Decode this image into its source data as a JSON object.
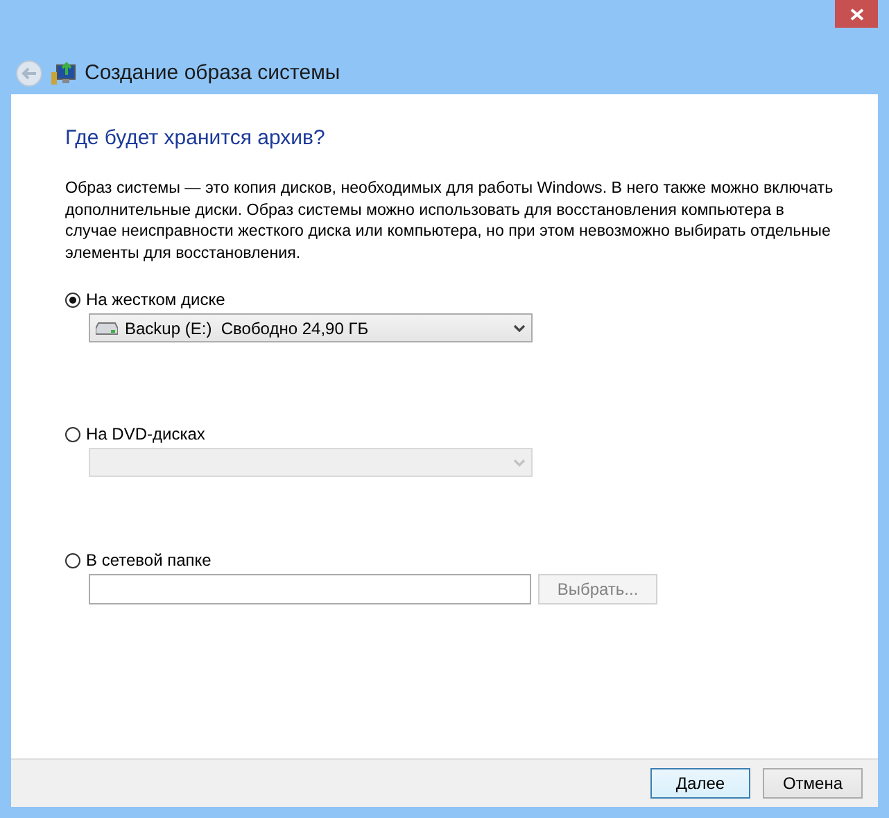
{
  "window": {
    "title": "Создание образа системы"
  },
  "heading": "Где будет хранится архив?",
  "description": "Образ системы — это копия дисков, необходимых для работы Windows. В него также можно включать дополнительные диски. Образ системы можно использовать для восстановления компьютера в случае неисправности жесткого диска или компьютера, но при этом невозможно выбирать отдельные элементы для восстановления.",
  "targets": [
    {
      "kind": "dropdown",
      "label": "На жестком диске",
      "selected": true,
      "disabled": false,
      "value": "Backup (E:)  Свободно 24,90 ГБ"
    },
    {
      "kind": "dropdown",
      "label": "На DVD-дисках",
      "selected": false,
      "disabled": true
    },
    {
      "kind": "path",
      "label": "В сетевой папке",
      "selected": false,
      "browse": {
        "label": "Выбрать...",
        "disabled": true
      }
    }
  ],
  "buttons": [
    {
      "label": "Далее",
      "default": true
    },
    {
      "label": "Отмена",
      "default": false
    }
  ]
}
